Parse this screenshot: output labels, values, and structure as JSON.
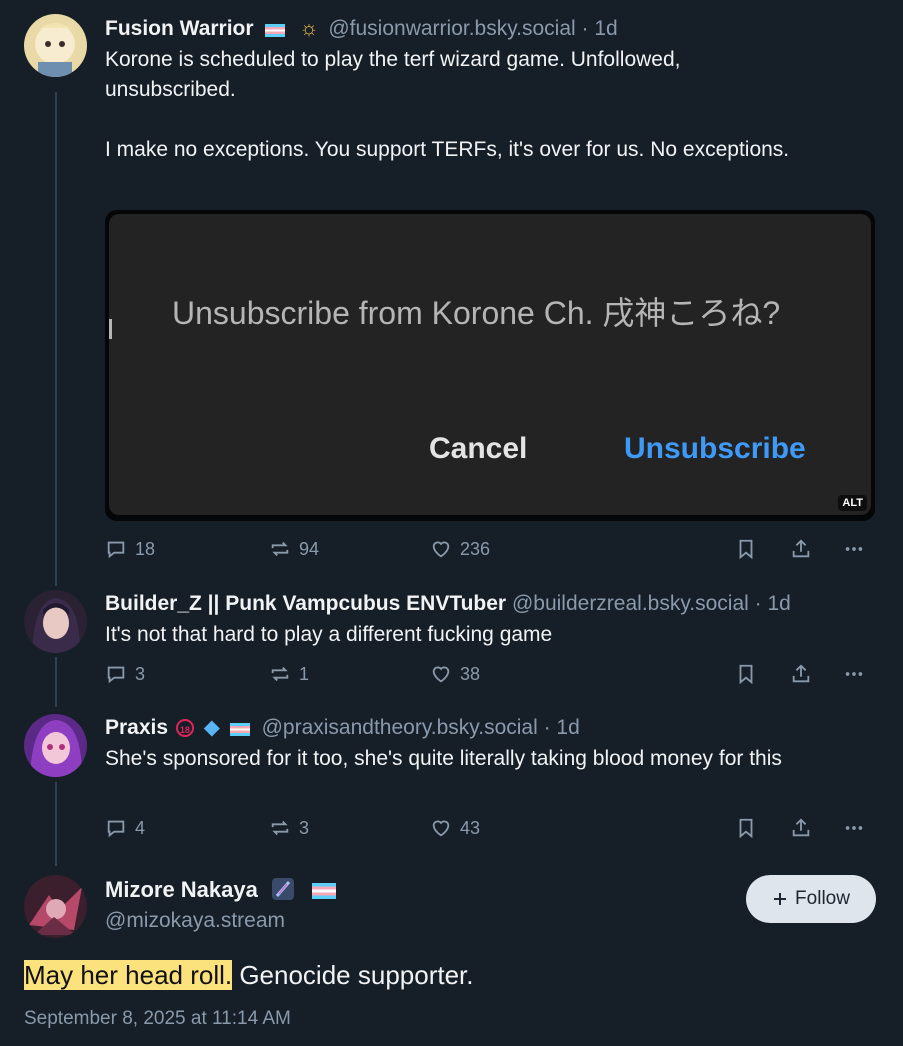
{
  "posts": [
    {
      "author": "Fusion Warrior",
      "handle": "@fusionwarrior.bsky.social",
      "time": "· 1d",
      "text1": "Korone is scheduled to play the terf wizard game. Unfollowed, unsubscribed.",
      "text2": "I make no exceptions. You support TERFs, it's over for us. No exceptions.",
      "embed": {
        "dialog_title": "Unsubscribe from Korone Ch. 戌神ころね?",
        "cancel_label": "Cancel",
        "unsubscribe_label": "Unsubscribe",
        "alt_badge": "ALT"
      },
      "replies": "18",
      "reposts": "94",
      "likes": "236"
    },
    {
      "author": "Builder_Z || Punk Vampcubus ENVTuber",
      "handle": "@builderzreal.bsky.social",
      "time": "· 1d",
      "text": "It's not that hard to play a different fucking game",
      "replies": "3",
      "reposts": "1",
      "likes": "38"
    },
    {
      "author": "Praxis",
      "handle": "@praxisandtheory.bsky.social",
      "time": "· 1d",
      "text": "She's sponsored for it too, she's quite literally taking blood money for this",
      "replies": "4",
      "reposts": "3",
      "likes": "43"
    }
  ],
  "main_post": {
    "author": "Mizore Nakaya",
    "handle": "@mizokaya.stream",
    "follow_label": "Follow",
    "text_highlight": "May her head roll.",
    "text_rest": " Genocide supporter.",
    "timestamp": "September 8, 2025 at 11:14 AM"
  },
  "badges": {
    "no_under_18": "18"
  },
  "colors": {
    "background": "#161e27",
    "muted": "#8a9aab",
    "link": "#3f9af7",
    "highlight": "#fbe27c"
  }
}
